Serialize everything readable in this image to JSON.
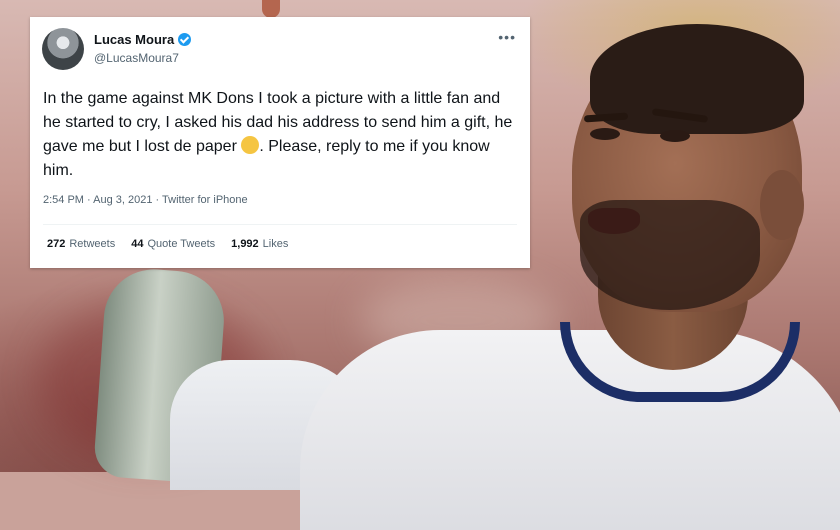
{
  "tweet": {
    "display_name": "Lucas Moura",
    "handle": "@LucasMoura7",
    "more_label": "•••",
    "text_before_emoji": "In the game against MK Dons I took a picture with a little fan and he started to cry, I asked his dad his address to send him a gift, he gave me but I lost de paper ",
    "text_after_emoji": ". Please, reply to me if you know him.",
    "emoji_icon": "pensive-face-emoji",
    "timestamp": "2:54 PM · Aug 3, 2021 · Twitter for iPhone",
    "stats": [
      {
        "count": "272",
        "label": "Retweets"
      },
      {
        "count": "44",
        "label": "Quote Tweets"
      },
      {
        "count": "1,992",
        "label": "Likes"
      }
    ]
  },
  "colors": {
    "verified_badge": "#1d9bf0",
    "secondary_text": "#536471",
    "primary_text": "#0f1419",
    "jersey_collar": "#1c2e66"
  }
}
